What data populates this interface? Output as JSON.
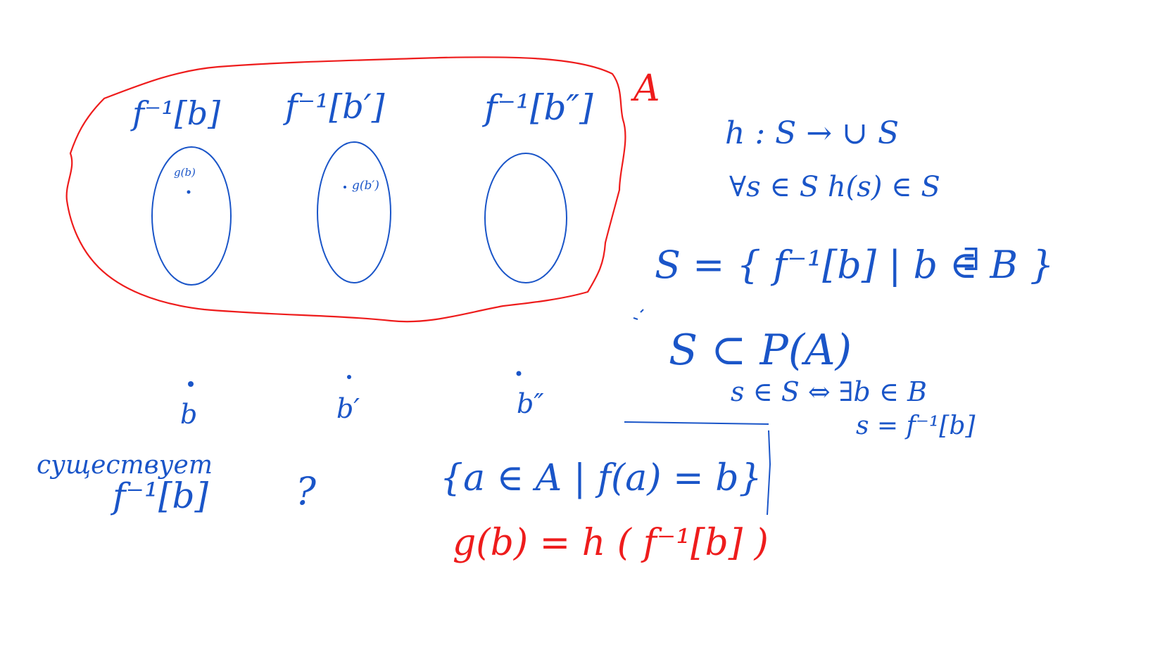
{
  "colors": {
    "ink_blue": "#1a55c8",
    "ink_red": "#ee1c1c",
    "background": "#ffffff"
  },
  "set_a": {
    "label": "A",
    "preimages": [
      "f⁻¹[b]",
      "f⁻¹[b′]",
      "f⁻¹[b″]"
    ],
    "chosen_points": [
      "g(b)",
      "g(b′)"
    ]
  },
  "codomain_points": [
    "b",
    "b′",
    "b″"
  ],
  "notes": {
    "choice_function": "h : S → ∪ S",
    "choice_property": "∀s ∈ S  h(s) ∈ S",
    "family_definition": "S = { f⁻¹[b] | b ∈ B }",
    "trailing_symbol": "∃",
    "subset": "S ⊂ P(A)",
    "membership": "s ∈ S ⇔ ∃b ∈ B",
    "membership_cont": "s = f⁻¹[b]",
    "exists_word": "существует",
    "exists_preimage": "f⁻¹[b]",
    "question_mark": "?",
    "preimage_set": "{a ∈ A | f(a) = b}",
    "definition_of_g": "g(b) = h ( f⁻¹[b] )"
  }
}
